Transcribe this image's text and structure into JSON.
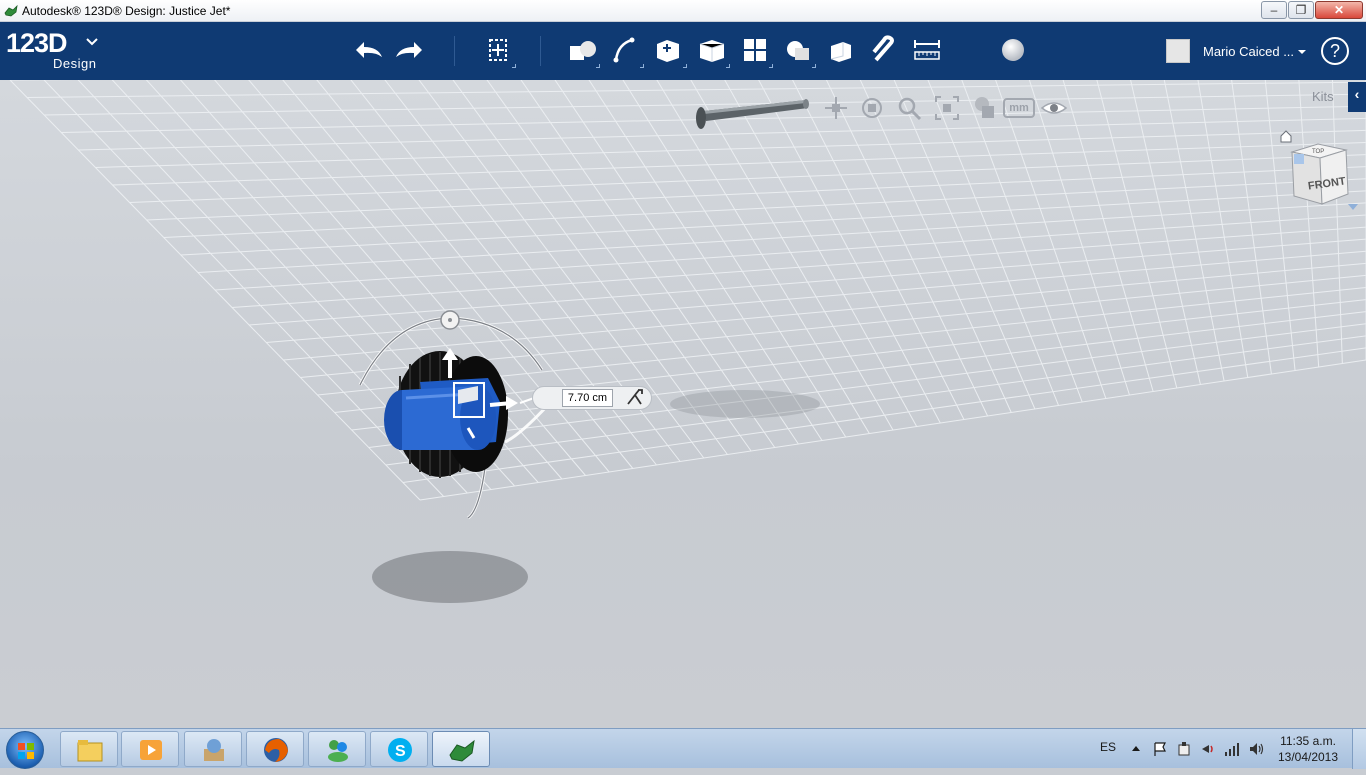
{
  "window": {
    "title": "Autodesk® 123D® Design: Justice Jet*",
    "minimize_label": "–",
    "maximize_label": "❐",
    "close_label": "✕"
  },
  "ribbon": {
    "logo_text": "123D",
    "logo_sub": "Design",
    "tools": [
      {
        "name": "undo-icon"
      },
      {
        "name": "redo-icon"
      },
      {
        "name": "transform-icon"
      },
      {
        "name": "primitives-icon"
      },
      {
        "name": "sketch-icon"
      },
      {
        "name": "construct-icon"
      },
      {
        "name": "modify-icon"
      },
      {
        "name": "pattern-icon"
      },
      {
        "name": "group-icon"
      },
      {
        "name": "combine-icon"
      },
      {
        "name": "snap-icon"
      },
      {
        "name": "measure-icon"
      },
      {
        "name": "material-icon"
      }
    ],
    "user_name": "Mario Caiced ...",
    "help_label": "?",
    "accent": "#0f3a73"
  },
  "viewport": {
    "kits_label": "Kits",
    "kits_toggle": "‹",
    "units_label": "mm",
    "viewcube_top": "TOP",
    "viewcube_front": "FRONT",
    "dimension_value": "7.70 cm",
    "selected_color": "#1f5bc4"
  },
  "taskbar": {
    "language": "ES",
    "time": "11:35 a.m.",
    "date": "13/04/2013",
    "apps": [
      {
        "name": "explorer-icon"
      },
      {
        "name": "media-player-icon"
      },
      {
        "name": "app-gallery-icon"
      },
      {
        "name": "firefox-icon"
      },
      {
        "name": "messenger-icon"
      },
      {
        "name": "skype-icon"
      },
      {
        "name": "123d-design-icon"
      }
    ]
  }
}
